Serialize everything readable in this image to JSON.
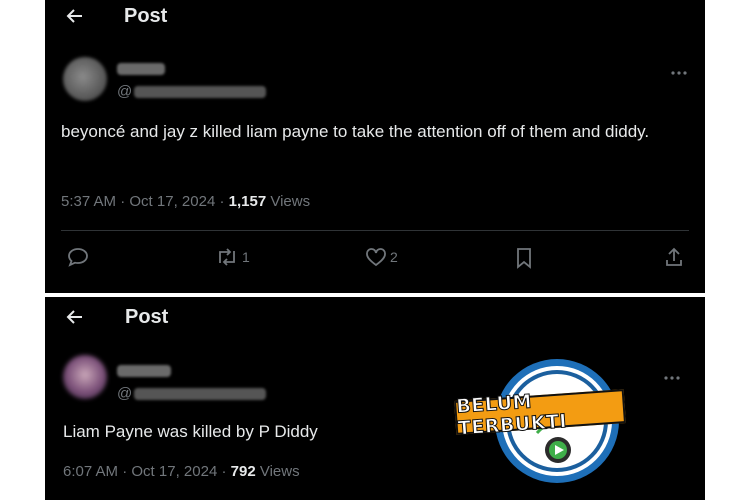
{
  "screens": [
    {
      "header": {
        "title": "Post"
      },
      "handle_prefix": "@",
      "tweet_text": "beyoncé and jay z killed liam payne to take the attention off of them and diddy.",
      "time": "5:37 AM",
      "date": "Oct 17, 2024",
      "views_count": "1,157",
      "views_label": "Views",
      "retweets": "1",
      "likes": "2"
    },
    {
      "header": {
        "title": "Post"
      },
      "handle_prefix": "@",
      "tweet_text": "Liam Payne was killed by P Diddy",
      "time": "6:07 AM",
      "date": "Oct 17, 2024",
      "views_count": "792",
      "views_label": "Views"
    }
  ],
  "stamp": {
    "label": "BELUM TERBUKTI",
    "color_bg": "#f39c12",
    "ring_color": "#1e6fb8"
  },
  "icons": [
    "back-arrow-icon",
    "more-icon",
    "reply-icon",
    "retweet-icon",
    "like-icon",
    "bookmark-icon",
    "share-icon"
  ]
}
